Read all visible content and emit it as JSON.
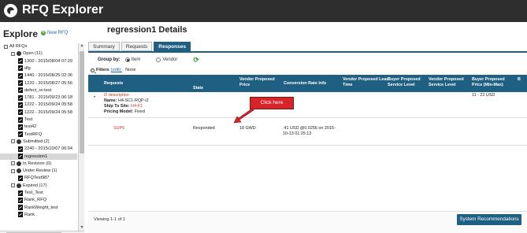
{
  "app": {
    "title": "RFQ Explorer"
  },
  "sidebar": {
    "heading": "Explore",
    "new_rfq_label": "New RFQ",
    "tree": [
      {
        "label": "All RFQs",
        "icon": "tree-box-icon",
        "level": 0
      },
      {
        "label": "Open (11)",
        "icon": "globe-icon",
        "level": 1
      },
      {
        "label": "1300 - 2015/08/04 07:29",
        "icon": "document-icon",
        "level": 2
      },
      {
        "label": "dfg",
        "icon": "document-icon",
        "level": 2
      },
      {
        "label": "1440 - 2015/08/25 02:36",
        "icon": "document-icon",
        "level": 2
      },
      {
        "label": "1220 - 2015/08/27 05:56",
        "icon": "document-icon",
        "level": 2
      },
      {
        "label": "defect_re-test",
        "icon": "document-icon",
        "level": 2
      },
      {
        "label": "1781 - 2015/09/23 06:18",
        "icon": "document-icon",
        "level": 2
      },
      {
        "label": "1222 - 2015/09/24 05:58",
        "icon": "document-icon",
        "level": 2
      },
      {
        "label": "1222 - 2015/09/24 05:58",
        "icon": "document-icon",
        "level": 2
      },
      {
        "label": "Test",
        "icon": "document-icon",
        "level": 2
      },
      {
        "label": "test42",
        "icon": "document-icon",
        "level": 2
      },
      {
        "label": "TestRFQ",
        "icon": "document-icon",
        "level": 2
      },
      {
        "label": "Submitted (2)",
        "icon": "globe-icon",
        "level": 1
      },
      {
        "label": "2240 - 2015/10/07 06:04",
        "icon": "document-icon",
        "level": 2
      },
      {
        "label": "regression1",
        "icon": "document-icon",
        "level": 2,
        "selected": true
      },
      {
        "label": "In Revision (0)",
        "icon": "globe-icon",
        "level": 1
      },
      {
        "label": "Under Review (1)",
        "icon": "globe-icon",
        "level": 1
      },
      {
        "label": "RFQTest987",
        "icon": "document-icon",
        "level": 2
      },
      {
        "label": "Expired (17)",
        "icon": "globe-icon",
        "level": 1
      },
      {
        "label": "Test_Test",
        "icon": "document-icon",
        "level": 2
      },
      {
        "label": "Rank_RFQ",
        "icon": "document-icon",
        "level": 2
      },
      {
        "label": "RankWeight_test",
        "icon": "document-icon",
        "level": 2
      },
      {
        "label": "Rank",
        "icon": "document-icon",
        "level": 2
      }
    ]
  },
  "main": {
    "title": "regression1 Details",
    "tabs": [
      {
        "label": "Summary",
        "active": false
      },
      {
        "label": "Requests",
        "active": false
      },
      {
        "label": "Responses",
        "active": true
      }
    ],
    "group_by": {
      "label": "Group by:",
      "options": [
        "Item",
        "Vendor"
      ],
      "selected": "Item"
    },
    "filters": {
      "label": "Filters",
      "edit": "(edit):",
      "value": "None"
    },
    "grid": {
      "columns": [
        "Requests",
        "State",
        "Vendor Proposed Price",
        "Conversion Rate Info",
        "Vendor Proposed Lead Time",
        "Buyer Proposed Service Level",
        "Vendor Proposed Service Level",
        "Buyer Proposed Price (Min-Max)",
        "B"
      ],
      "group_row": {
        "description": "i2 description",
        "name_label": "Name:",
        "name_value": "H4-SC1-RQP-i2",
        "ship_label": "Ship To Site:",
        "ship_value": "H4-F1",
        "pricing_label": "Pricing Model:",
        "pricing_value": "Fixed",
        "buyer_price": "11 - 22 USD"
      },
      "response_row": {
        "vendor": "SUP6",
        "state": "Responded",
        "price": "18 GWD",
        "conversion_line1": ".41 USD @0.0256 on 2015-",
        "conversion_line2": "10-13 01:25:13"
      }
    },
    "callout": "Click here",
    "footer": {
      "viewing": "Viewing 1-1 of 1",
      "button": "System Recommendations"
    }
  },
  "colors": {
    "topbar": "#2e2e2e",
    "accent": "#1f5f82",
    "callout": "#d8232a",
    "link_red": "#c0392b"
  }
}
